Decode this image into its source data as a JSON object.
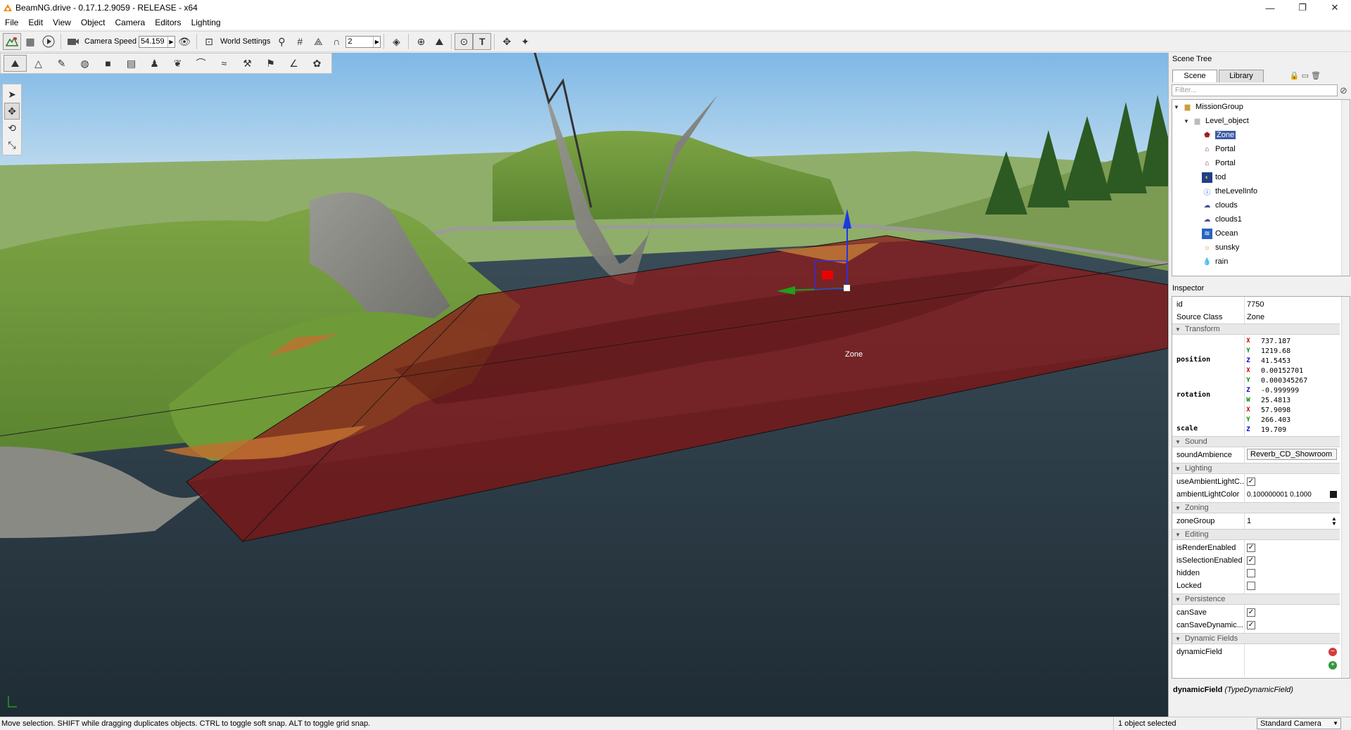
{
  "window": {
    "title": "BeamNG.drive - 0.17.1.2.9059 - RELEASE - x64",
    "controls": [
      "—",
      "❐",
      "✕"
    ]
  },
  "menu": [
    "File",
    "Edit",
    "View",
    "Object",
    "Camera",
    "Editors",
    "Lighting"
  ],
  "toolbar": {
    "camera_speed_label": "Camera Speed",
    "camera_speed_value": "54.159",
    "world_settings_label": "World Settings",
    "grid_value": "2"
  },
  "viewport": {
    "selected_label": "Zone"
  },
  "scene_tree": {
    "title": "Scene Tree",
    "tabs": [
      "Scene",
      "Library"
    ],
    "filter_placeholder": "Filter...",
    "items": [
      {
        "label": "MissionGroup",
        "icon": "folder-icon"
      },
      {
        "label": "Level_object",
        "icon": "folder-icon"
      },
      {
        "label": "Zone",
        "icon": "zone-icon"
      },
      {
        "label": "Portal",
        "icon": "portal-icon"
      },
      {
        "label": "Portal",
        "icon": "portal-icon"
      },
      {
        "label": "tod",
        "icon": "time-of-day-icon"
      },
      {
        "label": "theLevelInfo",
        "icon": "info-icon"
      },
      {
        "label": "clouds",
        "icon": "cloud-icon"
      },
      {
        "label": "clouds1",
        "icon": "cloud-icon"
      },
      {
        "label": "Ocean",
        "icon": "water-icon"
      },
      {
        "label": "sunsky",
        "icon": "sun-icon"
      },
      {
        "label": "rain",
        "icon": "rain-icon"
      }
    ]
  },
  "inspector": {
    "title": "Inspector",
    "id_label": "id",
    "id_value": "7750",
    "class_label": "Source Class",
    "class_value": "Zone",
    "sections": {
      "transform": "Transform",
      "sound": "Sound",
      "lighting": "Lighting",
      "zoning": "Zoning",
      "editing": "Editing",
      "persistence": "Persistence",
      "dynamic": "Dynamic Fields"
    },
    "position_label": "position",
    "position": {
      "x": "737.187",
      "y": "1219.68",
      "z": "41.5453"
    },
    "rotation_label": "rotation",
    "rotation": {
      "x": "0.00152701",
      "y": "0.000345267",
      "z": "-0.999999",
      "w": "25.4813"
    },
    "scale_label": "scale",
    "scale": {
      "x": "57.9098",
      "y": "266.403",
      "z": "19.709"
    },
    "sound_ambience_label": "soundAmbience",
    "sound_ambience_value": "Reverb_CD_Showroom",
    "use_ambient_label": "useAmbientLightC...",
    "ambient_color_label": "ambientLightColor",
    "ambient_color_value": "0.100000001 0.1000",
    "zone_group_label": "zoneGroup",
    "zone_group_value": "1",
    "render_enabled_label": "isRenderEnabled",
    "selection_enabled_label": "isSelectionEnabled",
    "hidden_label": "hidden",
    "locked_label": "Locked",
    "can_save_label": "canSave",
    "can_save_dynamic_label": "canSaveDynamic...",
    "dynamic_field_label": "dynamicField",
    "help_name": "dynamicField",
    "help_type": "(TypeDynamicField)"
  },
  "status": {
    "message": "Move selection.  SHIFT while dragging duplicates objects.  CTRL to toggle soft snap.  ALT to toggle grid snap.",
    "selection": "1 object selected",
    "camera_mode": "Standard Camera"
  },
  "colors": {
    "zone_fill": "#8b1a1a",
    "sky_top": "#7fb8e6",
    "sky_bottom": "#cfe6f2",
    "ocean": "#26343f",
    "grass": "#6d9a3a",
    "selection": "#3b5ba5"
  }
}
